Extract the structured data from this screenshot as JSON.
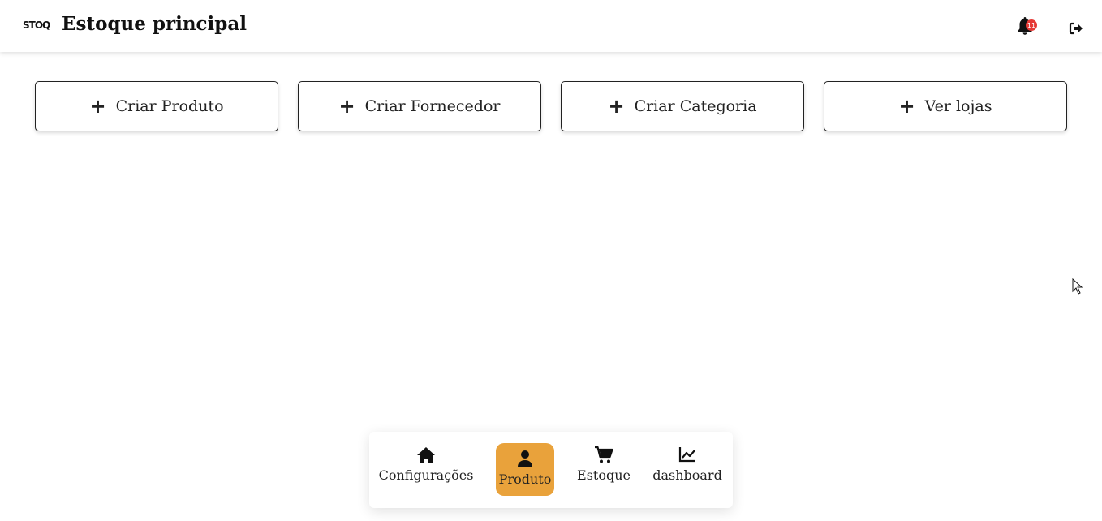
{
  "header": {
    "logo_text": "STOQ",
    "title": "Estoque principal",
    "notifications_count": "11",
    "icons": {
      "bell": "bell-icon",
      "logout": "logout-icon"
    }
  },
  "actions": [
    {
      "label": "Criar Produto"
    },
    {
      "label": "Criar Fornecedor"
    },
    {
      "label": "Criar Categoria"
    },
    {
      "label": "Ver lojas"
    }
  ],
  "bottom_nav": {
    "active_color": "#e9a23b",
    "items": [
      {
        "label": "Configurações",
        "icon": "home-icon"
      },
      {
        "label": "Produto",
        "icon": "user-icon",
        "active": true
      },
      {
        "label": "Estoque",
        "icon": "cart-icon"
      },
      {
        "label": "dashboard",
        "icon": "chart-line-icon"
      }
    ]
  },
  "colors": {
    "badge": "#e53935",
    "accent": "#e9a23b"
  }
}
